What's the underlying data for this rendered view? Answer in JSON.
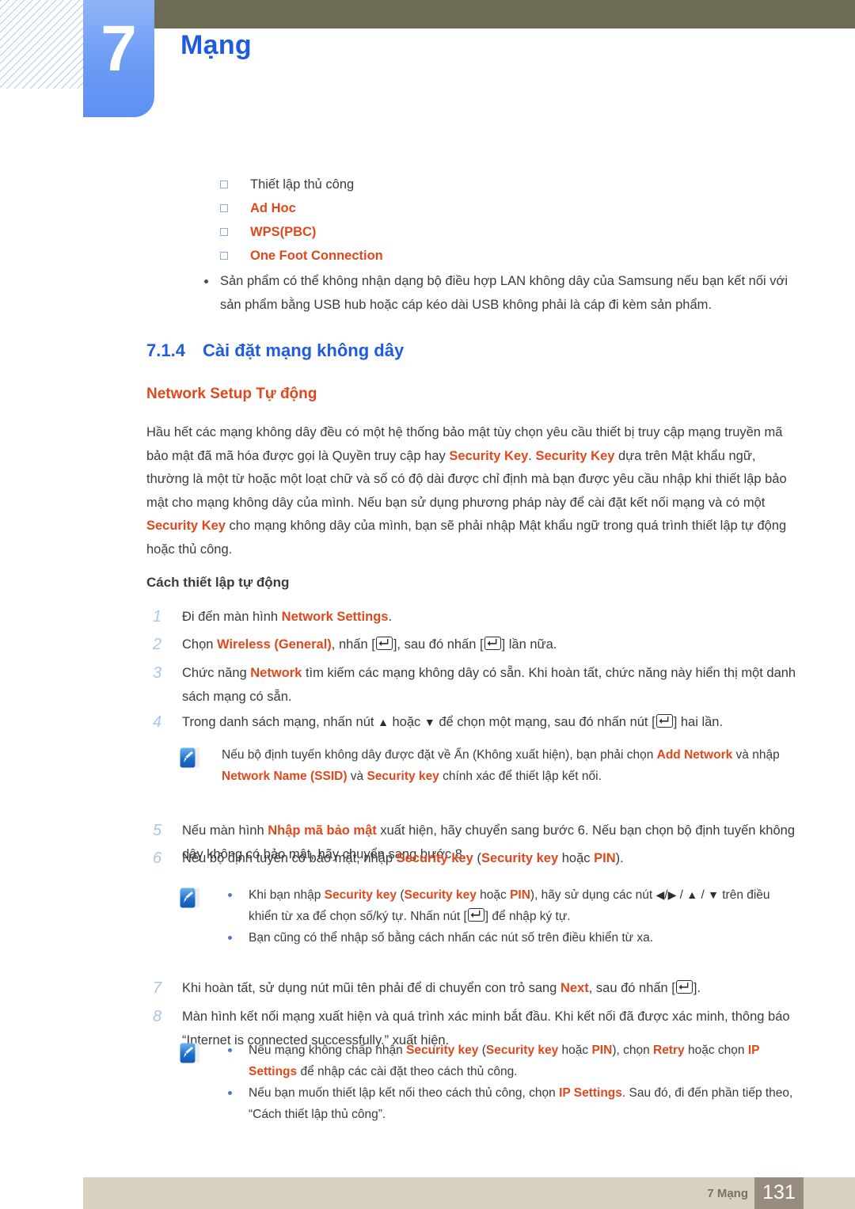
{
  "header": {
    "chapter_number": "7",
    "chapter_title": "Mạng",
    "hatch_icon": "diagonal-hatch-pattern",
    "colors": {
      "tab_blue": "#6b9bf5",
      "olive_bar": "#6e6b57",
      "title_blue": "#1e5bde"
    }
  },
  "sub_bullets": [
    {
      "label": "Thiết lập thủ công",
      "accent": false
    },
    {
      "label": "Ad Hoc",
      "accent": true
    },
    {
      "label": "WPS(PBC)",
      "accent": true
    },
    {
      "label": "One Foot Connection",
      "accent": true
    }
  ],
  "note_bullet_top": {
    "line1": "Sản phẩm có thể không nhận dạng bộ điều hợp LAN không dây của Samsung nếu bạn kết nối",
    "line2": "với sản phẩm bằng USB hub hoặc cáp kéo dài USB không phải là cáp đi kèm sản phẩm."
  },
  "section": {
    "number": "7.1.4",
    "title": "Cài đặt mạng không dây",
    "subtitle": "Network Setup Tự động"
  },
  "paragraph": {
    "p1": "Hầu hết các mạng không dây đều có một hệ thống bảo mật tùy chọn yêu cầu thiết bị truy cập mạng truyền mã bảo mật đã mã hóa được gọi là Quyền truy cập hay ",
    "kw1": "Security Key",
    "p2": ". ",
    "kw2": "Security Key",
    "p3": " dựa trên Mật khẩu ngữ, thường là một từ hoặc một loạt chữ và số có độ dài được chỉ định mà bạn được yêu cầu nhập khi thiết lập bảo mật cho mạng không dây của mình. Nếu bạn sử dụng phương pháp này để cài đặt kết nối mạng và có một ",
    "kw3": "Security Key",
    "p4": " cho mạng không dây của mình, bạn sẽ phải nhập Mật khẩu ngữ trong quá trình thiết lập tự động hoặc thủ công."
  },
  "procedure": {
    "heading": "Cách thiết lập tự động",
    "steps": [
      {
        "num": "1",
        "parts": [
          {
            "t": "Đi đến màn hình ",
            "s": "plain"
          },
          {
            "t": "Network Settings",
            "s": "kw"
          },
          {
            "t": ".",
            "s": "plain"
          }
        ]
      },
      {
        "num": "2",
        "parts": [
          {
            "t": "Chọn ",
            "s": "plain"
          },
          {
            "t": "Wireless (General)",
            "s": "kw"
          },
          {
            "t": ", nhấn [",
            "s": "plain"
          },
          {
            "t": "enter-key-icon",
            "s": "key"
          },
          {
            "t": "], sau đó nhấn [",
            "s": "plain"
          },
          {
            "t": "enter-key-icon",
            "s": "key"
          },
          {
            "t": "] lần nữa.",
            "s": "plain"
          }
        ]
      },
      {
        "num": "3",
        "parts": [
          {
            "t": "Chức năng ",
            "s": "plain"
          },
          {
            "t": "Network",
            "s": "kw"
          },
          {
            "t": " tìm kiếm các mạng không dây có sẵn. Khi hoàn tất, chức năng này hiển thị một danh sách mạng có sẵn.",
            "s": "plain"
          }
        ]
      },
      {
        "num": "4",
        "parts": [
          {
            "t": "Trong danh sách mạng, nhấn nút ",
            "s": "plain"
          },
          {
            "t": "▲",
            "s": "arrow"
          },
          {
            "t": " hoặc ",
            "s": "plain"
          },
          {
            "t": "▼",
            "s": "arrow"
          },
          {
            "t": " để chọn một mạng, sau đó nhấn nút [",
            "s": "plain"
          },
          {
            "t": "enter-key-icon",
            "s": "key"
          },
          {
            "t": "] hai lần.",
            "s": "plain"
          }
        ]
      },
      {
        "num": "5",
        "parts": [
          {
            "t": "Nếu màn hình ",
            "s": "plain"
          },
          {
            "t": "Nhập mã bảo mật",
            "s": "kw"
          },
          {
            "t": " xuất hiện, hãy chuyển sang bước 6. Nếu bạn chọn bộ định tuyến không dây không có bảo mật, hãy chuyển sang bước 8.",
            "s": "plain"
          }
        ]
      },
      {
        "num": "6",
        "parts": [
          {
            "t": "Nếu bộ định tuyến có bảo mật, nhập ",
            "s": "plain"
          },
          {
            "t": "Security key",
            "s": "kw"
          },
          {
            "t": " (",
            "s": "plain"
          },
          {
            "t": "Security key",
            "s": "kw"
          },
          {
            "t": " hoặc ",
            "s": "plain"
          },
          {
            "t": "PIN",
            "s": "kw"
          },
          {
            "t": ").",
            "s": "plain"
          }
        ]
      },
      {
        "num": "7",
        "parts": [
          {
            "t": "Khi hoàn tất, sử dụng nút mũi tên phải để di chuyển con trỏ sang ",
            "s": "plain"
          },
          {
            "t": "Next",
            "s": "kw"
          },
          {
            "t": ", sau đó nhấn [",
            "s": "plain"
          },
          {
            "t": "enter-key-icon",
            "s": "key"
          },
          {
            "t": "].",
            "s": "plain"
          }
        ]
      },
      {
        "num": "8",
        "parts": [
          {
            "t": "Màn hình kết nối mạng xuất hiện và quá trình xác minh bắt đầu. Khi kết nối đã được xác minh, thông báo “Internet is connected successfully.” xuất hiện.",
            "s": "plain"
          }
        ]
      }
    ]
  },
  "notes": [
    {
      "icon": "note-pen-icon",
      "lines": [
        {
          "bulleted": false,
          "parts": [
            {
              "t": "Nếu bộ định tuyến không dây được đặt về Ẩn (Không xuất hiện), bạn phải chọn ",
              "s": "plain"
            },
            {
              "t": "Add Network",
              "s": "kw"
            },
            {
              "t": " và nhập ",
              "s": "plain"
            },
            {
              "t": "Network Name (SSID)",
              "s": "kw"
            },
            {
              "t": " và ",
              "s": "plain"
            },
            {
              "t": "Security key",
              "s": "kw"
            },
            {
              "t": " chính xác để thiết lập kết nối.",
              "s": "plain"
            }
          ]
        }
      ]
    },
    {
      "icon": "note-pen-icon",
      "lines": [
        {
          "bulleted": true,
          "parts": [
            {
              "t": "Khi bạn nhập ",
              "s": "plain"
            },
            {
              "t": "Security key",
              "s": "kw"
            },
            {
              "t": " (",
              "s": "plain"
            },
            {
              "t": "Security key",
              "s": "kw"
            },
            {
              "t": " hoặc ",
              "s": "plain"
            },
            {
              "t": "PIN",
              "s": "kw"
            },
            {
              "t": "), hãy sử dụng các nút ",
              "s": "plain"
            },
            {
              "t": "◀",
              "s": "arrow"
            },
            {
              "t": "/",
              "s": "plain"
            },
            {
              "t": "▶",
              "s": "arrow"
            },
            {
              "t": " / ",
              "s": "plain"
            },
            {
              "t": "▲",
              "s": "arrow"
            },
            {
              "t": " / ",
              "s": "plain"
            },
            {
              "t": "▼",
              "s": "arrow"
            },
            {
              "t": " trên điều khiển từ xa để chọn số/ký tự. Nhấn nút [",
              "s": "plain"
            },
            {
              "t": "enter-key-icon",
              "s": "key"
            },
            {
              "t": "] để nhập ký tự.",
              "s": "plain"
            }
          ]
        },
        {
          "bulleted": true,
          "parts": [
            {
              "t": "Bạn cũng có thể nhập số bằng cách nhấn các nút số trên điều khiển từ xa.",
              "s": "plain"
            }
          ]
        }
      ]
    },
    {
      "icon": "note-pen-icon",
      "lines": [
        {
          "bulleted": true,
          "parts": [
            {
              "t": "Nếu mạng không chấp nhận ",
              "s": "plain"
            },
            {
              "t": "Security key",
              "s": "kw"
            },
            {
              "t": " (",
              "s": "plain"
            },
            {
              "t": "Security key",
              "s": "kw"
            },
            {
              "t": " hoặc ",
              "s": "plain"
            },
            {
              "t": "PIN",
              "s": "kw"
            },
            {
              "t": "), chọn ",
              "s": "plain"
            },
            {
              "t": "Retry",
              "s": "kw"
            },
            {
              "t": " hoặc chọn ",
              "s": "plain"
            },
            {
              "t": "IP Settings",
              "s": "kw"
            },
            {
              "t": " để nhập các cài đặt theo cách thủ công.",
              "s": "plain"
            }
          ]
        },
        {
          "bulleted": true,
          "parts": [
            {
              "t": "Nếu bạn muốn thiết lập kết nối theo cách thủ công, chọn ",
              "s": "plain"
            },
            {
              "t": "IP Settings",
              "s": "kw"
            },
            {
              "t": ". Sau đó, đi đến phần tiếp theo, “Cách thiết lập thủ công”.",
              "s": "plain"
            }
          ]
        }
      ]
    }
  ],
  "footer": {
    "label": "7 Mạng",
    "page_number": "131",
    "colors": {
      "band": "#d7d2bf",
      "page_box": "#978b7e"
    }
  }
}
